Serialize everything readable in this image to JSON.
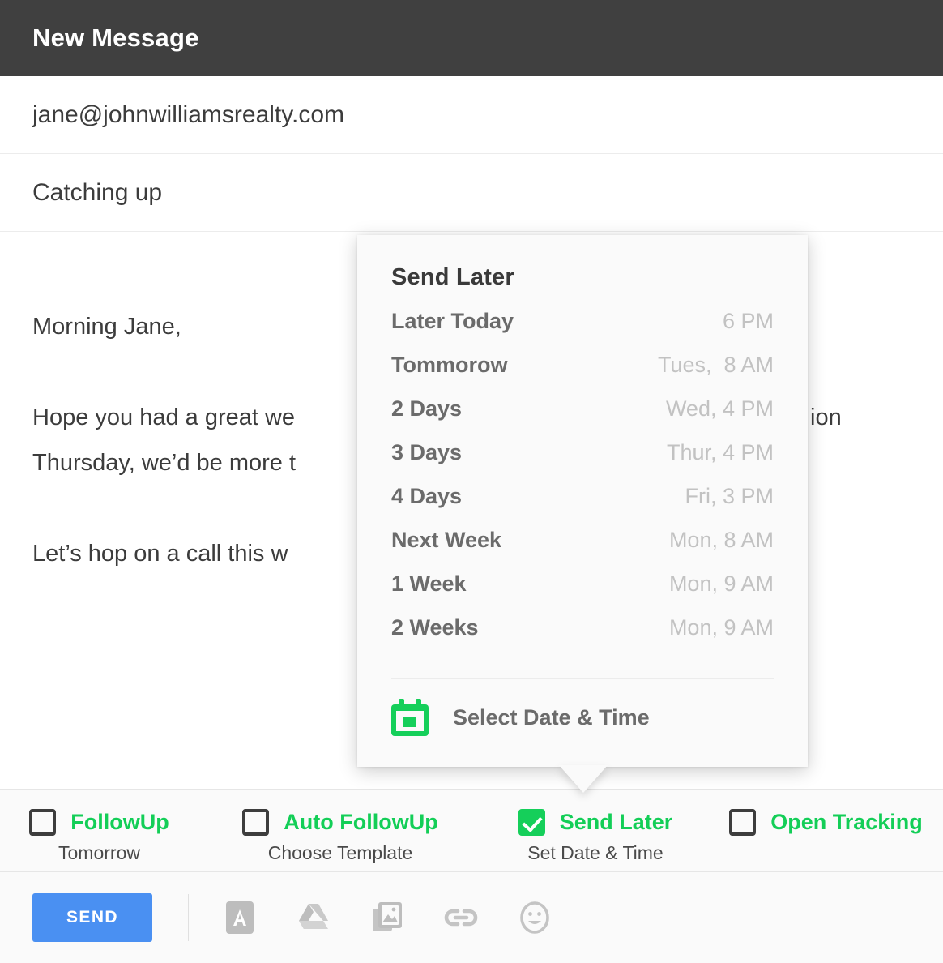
{
  "window": {
    "title": "New Message"
  },
  "compose": {
    "to": "jane@johnwilliamsrealty.com",
    "subject": "Catching up",
    "body_lines": [
      "Morning Jane,",
      "Hope you had a great we",
      "Thursday, we’d be more t",
      "Let’s hop on a call this w"
    ],
    "body_right_fragment": "ion"
  },
  "popup": {
    "title": "Send Later",
    "rows": [
      {
        "label": "Later Today",
        "time": "6 PM"
      },
      {
        "label": "Tommorow",
        "time": "Tues,  8 AM"
      },
      {
        "label": "2 Days",
        "time": "Wed, 4 PM"
      },
      {
        "label": "3 Days",
        "time": "Thur, 4 PM"
      },
      {
        "label": "4 Days",
        "time": "Fri, 3 PM"
      },
      {
        "label": "Next Week",
        "time": "Mon, 8 AM"
      },
      {
        "label": "1 Week",
        "time": "Mon, 9 AM"
      },
      {
        "label": "2 Weeks",
        "time": "Mon, 9 AM"
      }
    ],
    "footer": {
      "icon": "calendar-icon",
      "label": "Select Date & Time"
    }
  },
  "options": [
    {
      "label": "FollowUp",
      "sub": "Tomorrow",
      "checked": false
    },
    {
      "label": "Auto FollowUp",
      "sub": "Choose Template",
      "checked": false
    },
    {
      "label": "Send Later",
      "sub": "Set Date & Time",
      "checked": true
    },
    {
      "label": "Open Tracking",
      "sub": "",
      "checked": false
    }
  ],
  "sendbar": {
    "send_label": "SEND",
    "tools": [
      "format-text-icon",
      "google-drive-icon",
      "insert-photo-icon",
      "insert-link-icon",
      "insert-emoji-icon"
    ]
  },
  "colors": {
    "header_bg": "#404040",
    "accent_green": "#15cf5a",
    "send_blue": "#4a90f2",
    "popup_bg": "#fafafa",
    "muted_text": "#c2c2c2"
  }
}
